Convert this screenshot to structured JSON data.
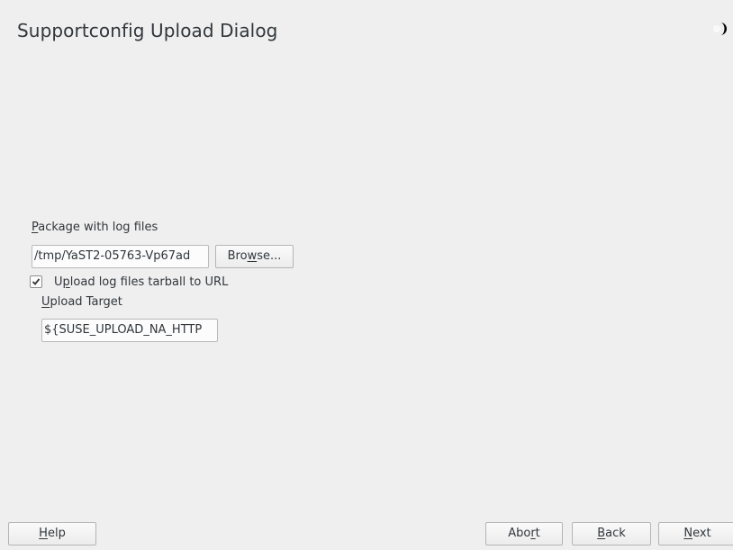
{
  "dialog": {
    "title": "Supportconfig Upload Dialog",
    "corner_icon": "half-moon-icon"
  },
  "form": {
    "package_label_mnemonic": "P",
    "package_label_rest": "ackage with log files",
    "package_value": "/tmp/YaST2-05763-Vp67ad",
    "browse_pre": "Bro",
    "browse_mnemonic": "w",
    "browse_post": "se...",
    "upload_checkbox_checked": true,
    "upload_pre": "U",
    "upload_mnemonic": "p",
    "upload_post": "load log files tarball to URL",
    "target_label_mnemonic": "U",
    "target_label_rest": "pload Target",
    "target_value": "${SUSE_UPLOAD_NA_HTTP"
  },
  "buttons": {
    "help_mnemonic": "H",
    "help_rest": "elp",
    "abort_pre": "Abo",
    "abort_mnemonic": "r",
    "abort_post": "t",
    "back_mnemonic": "B",
    "back_rest": "ack",
    "next_mnemonic": "N",
    "next_rest": "ext"
  }
}
